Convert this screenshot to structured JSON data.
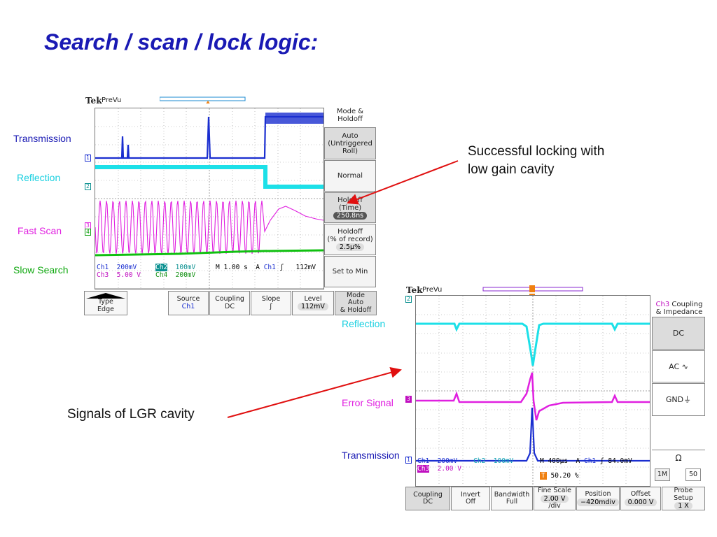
{
  "title": "Search / scan / lock logic:",
  "labels_left": {
    "transmission": "Transmission",
    "reflection": "Reflection",
    "fast_scan": "Fast Scan",
    "slow_search": "Slow Search"
  },
  "labels_right": {
    "reflection": "Reflection",
    "error_signal": "Error Signal",
    "transmission": "Transmission"
  },
  "annotations": {
    "locking_line1": "Successful locking with",
    "locking_line2": "low gain cavity",
    "lgr": "Signals of LGR cavity"
  },
  "colors": {
    "title": "#1a1ab4",
    "ch1": "#1a2ed0",
    "ch2": "#1ce0e8",
    "ch3": "#e020e0",
    "ch4": "#10c010",
    "arrow": "#e01010"
  },
  "scope1": {
    "brand": "Tek",
    "mode": "PreVu",
    "side_title": "Mode &\nHoldoff",
    "side_buttons": [
      {
        "line1": "Auto",
        "line2": "(Untriggered",
        "line3": "Roll)"
      },
      {
        "line1": "Normal"
      },
      {
        "line1": "Holdoff",
        "line2": "(Time)",
        "value": "250.8ns"
      },
      {
        "line1": "Holdoff",
        "line2": "(% of record)",
        "value": "2.5μ%"
      },
      {
        "line1": "Set to Min"
      }
    ],
    "readouts": {
      "ch1": "Ch1",
      "ch1_scale": "200mV",
      "ch2": "Ch2",
      "ch2_scale": "100mV",
      "ch3": "Ch3",
      "ch3_scale": "5.00 V",
      "ch4": "Ch4",
      "ch4_scale": "200mV",
      "timebase": "M 1.00 s",
      "trig": "A",
      "trig_src": "Ch1",
      "trig_slope": "ʃ",
      "trig_level": "112mV"
    },
    "bottom_buttons": [
      {
        "line1": "Type",
        "line2": "Edge"
      },
      {
        "line1": "Source",
        "line2": "Ch1"
      },
      {
        "line1": "Coupling",
        "line2": "DC"
      },
      {
        "line1": "Slope",
        "line2": "ʃ"
      },
      {
        "line1": "Level",
        "line2": "112mV"
      },
      {
        "line1": "Mode",
        "line2": "Auto",
        "line3": "& Holdoff"
      }
    ],
    "channel_markers": [
      "1",
      "2",
      "3",
      "4"
    ]
  },
  "scope2": {
    "brand": "Tek",
    "mode": "PreVu",
    "side_title_ch": "Ch3",
    "side_title": "Coupling\n& Impedance",
    "side_buttons": [
      {
        "line1": "DC"
      },
      {
        "line1": "AC ∿"
      },
      {
        "line1": "GND⏚"
      }
    ],
    "impedance": {
      "symbol": "Ω",
      "opt1": "1M",
      "opt2": "50"
    },
    "readouts": {
      "ch1": "Ch1",
      "ch1_scale": "200mV",
      "ch2": "Ch2",
      "ch2_scale": "100mV",
      "ch3": "Ch3",
      "ch3_scale": "2.00 V",
      "timebase": "M 400μs",
      "trig": "A",
      "trig_src": "Ch1",
      "trig_slope": "ʃ",
      "trig_level": "84.0mV",
      "trig_pos_marker": "T",
      "trig_pos": "50.20 %"
    },
    "bottom_buttons": [
      {
        "line1": "Coupling",
        "line2": "DC"
      },
      {
        "line1": "Invert",
        "line2": "Off"
      },
      {
        "line1": "Bandwidth",
        "line2": "Full"
      },
      {
        "line1": "Fine Scale",
        "line2": "2.00 V",
        "line3": "/div"
      },
      {
        "line1": "Position",
        "line2": "−420mdiv"
      },
      {
        "line1": "Offset",
        "line2": "0.000 V"
      },
      {
        "line1": "Probe",
        "line2": "Setup",
        "line3": "1 X"
      }
    ],
    "channel_markers": [
      "2",
      "3",
      "1"
    ]
  }
}
